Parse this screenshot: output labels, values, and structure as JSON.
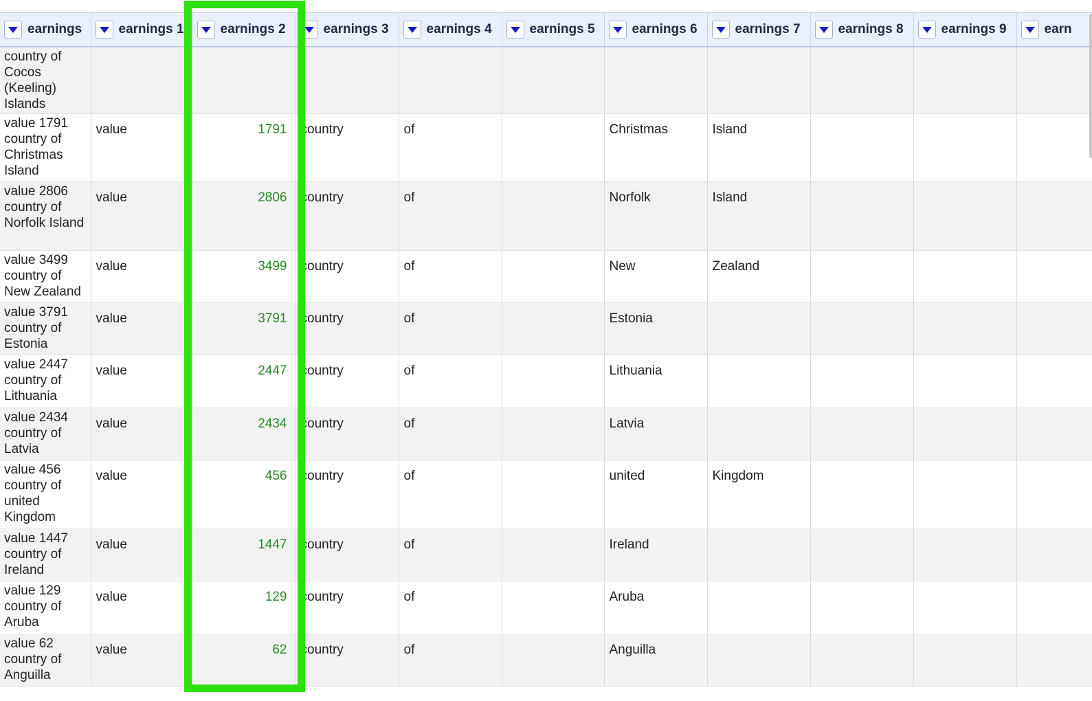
{
  "columns": [
    {
      "label": "earnings"
    },
    {
      "label": "earnings 1"
    },
    {
      "label": "earnings 2"
    },
    {
      "label": "earnings 3"
    },
    {
      "label": "earnings 4"
    },
    {
      "label": "earnings 5"
    },
    {
      "label": "earnings 6"
    },
    {
      "label": "earnings 7"
    },
    {
      "label": "earnings 8"
    },
    {
      "label": "earnings 9"
    },
    {
      "label": "earn"
    }
  ],
  "rows": [
    {
      "cells": [
        "country of Cocos (Keeling) Islands",
        "",
        "",
        "",
        "",
        "",
        "",
        "",
        "",
        "",
        ""
      ]
    },
    {
      "cells": [
        "value 1791 country of Christmas Island",
        "value",
        "1791",
        "country",
        "of",
        "",
        "Christmas",
        "Island",
        "",
        "",
        ""
      ]
    },
    {
      "cells": [
        "value 2806 country of Norfolk Island",
        "value",
        "2806",
        "country",
        "of",
        "",
        "Norfolk",
        "Island",
        "",
        "",
        ""
      ]
    },
    {
      "cells": [
        "value 3499 country of New Zealand",
        "value",
        "3499",
        "country",
        "of",
        "",
        "New",
        "Zealand",
        "",
        "",
        ""
      ]
    },
    {
      "cells": [
        "value 3791 country of Estonia",
        "value",
        "3791",
        "country",
        "of",
        "",
        "Estonia",
        "",
        "",
        "",
        ""
      ]
    },
    {
      "cells": [
        "value 2447 country of Lithuania",
        "value",
        "2447",
        "country",
        "of",
        "",
        "Lithuania",
        "",
        "",
        "",
        ""
      ]
    },
    {
      "cells": [
        "value 2434 country of Latvia",
        "value",
        "2434",
        "country",
        "of",
        "",
        "Latvia",
        "",
        "",
        "",
        ""
      ]
    },
    {
      "cells": [
        "value 456 country of united Kingdom",
        "value",
        "456",
        "country",
        "of",
        "",
        "united",
        "Kingdom",
        "",
        "",
        ""
      ]
    },
    {
      "cells": [
        "value 1447 country of Ireland",
        "value",
        "1447",
        "country",
        "of",
        "",
        "Ireland",
        "",
        "",
        "",
        ""
      ]
    },
    {
      "cells": [
        "value 129 country of Aruba",
        "value",
        "129",
        "country",
        "of",
        "",
        "Aruba",
        "",
        "",
        "",
        ""
      ]
    },
    {
      "cells": [
        "value 62 country of Anguilla",
        "value",
        "62",
        "country",
        "of",
        "",
        "Anguilla",
        "",
        "",
        "",
        ""
      ]
    }
  ],
  "highlight": {
    "column_label": "earnings 2",
    "color": "#2fe011"
  },
  "colors": {
    "header_bg": "#eaf0fb",
    "number_text": "#2b8a2b",
    "row_alt": "#f2f2f2",
    "dropdown_arrow": "#1a1acc"
  }
}
